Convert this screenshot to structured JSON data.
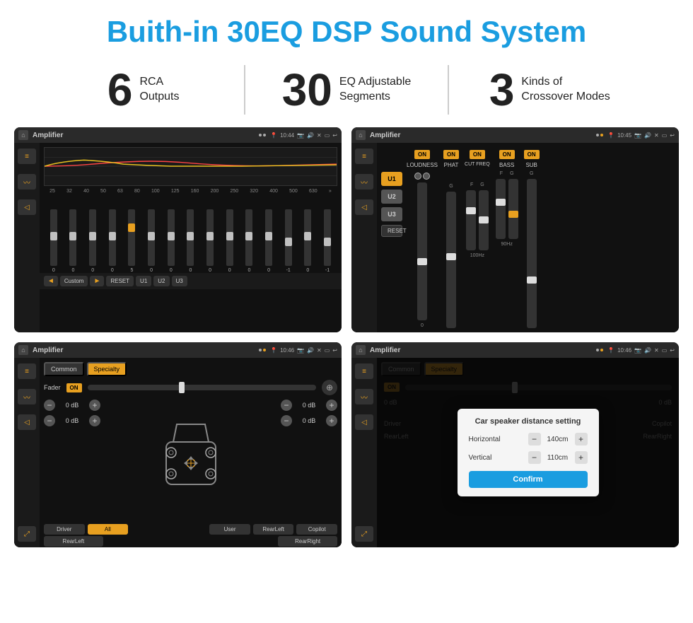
{
  "title": "Buith-in 30EQ DSP Sound System",
  "stats": [
    {
      "number": "6",
      "text": "RCA\nOutputs"
    },
    {
      "number": "30",
      "text": "EQ Adjustable\nSegments"
    },
    {
      "number": "3",
      "text": "Kinds of\nCrossover Modes"
    }
  ],
  "screens": [
    {
      "id": "eq",
      "title": "Amplifier",
      "time": "10:44",
      "eq_freqs": [
        "25",
        "32",
        "40",
        "50",
        "63",
        "80",
        "100",
        "125",
        "160",
        "200",
        "250",
        "320",
        "400",
        "500",
        "630"
      ],
      "eq_values": [
        "0",
        "0",
        "0",
        "0",
        "5",
        "0",
        "0",
        "0",
        "0",
        "0",
        "0",
        "0",
        "-1",
        "0",
        "-1"
      ],
      "bottom_btns": [
        "Custom",
        "RESET",
        "U1",
        "U2",
        "U3"
      ]
    },
    {
      "id": "crossover",
      "title": "Amplifier",
      "time": "10:45",
      "presets": [
        "U1",
        "U2",
        "U3"
      ],
      "controls": [
        "LOUDNESS",
        "PHAT",
        "CUT FREQ",
        "BASS",
        "SUB"
      ],
      "reset_label": "RESET"
    },
    {
      "id": "speaker",
      "title": "Amplifier",
      "time": "10:46",
      "tabs": [
        "Common",
        "Specialty"
      ],
      "fader_label": "Fader",
      "db_values": [
        "0 dB",
        "0 dB",
        "0 dB",
        "0 dB"
      ],
      "bottom_btns": [
        "Driver",
        "All",
        "User",
        "RearLeft",
        "RearRight",
        "Copilot"
      ]
    },
    {
      "id": "dialog",
      "title": "Amplifier",
      "time": "10:46",
      "tabs": [
        "Common",
        "Specialty"
      ],
      "dialog": {
        "title": "Car speaker distance setting",
        "horizontal_label": "Horizontal",
        "horizontal_value": "140cm",
        "vertical_label": "Vertical",
        "vertical_value": "110cm",
        "confirm_label": "Confirm"
      }
    }
  ]
}
